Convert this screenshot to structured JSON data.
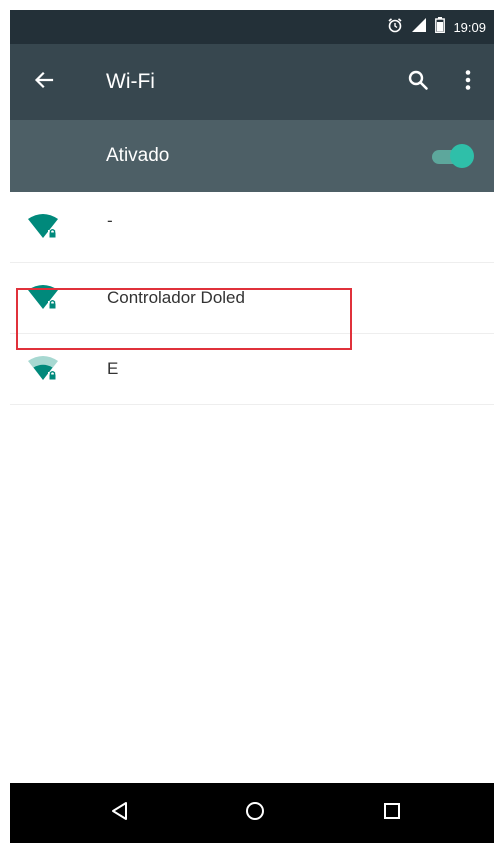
{
  "status_bar": {
    "time": "19:09",
    "icons": [
      "alarm-icon",
      "signal-icon",
      "battery-icon"
    ]
  },
  "app_bar": {
    "title": "Wi-Fi",
    "icons": [
      "back-arrow-icon",
      "search-icon",
      "more-vert-icon"
    ]
  },
  "wifi_toggle": {
    "label": "Ativado",
    "state": "on"
  },
  "networks": [
    {
      "name": "-",
      "secured": true,
      "signal_strength": "strong"
    },
    {
      "name": "Controlador Doled",
      "secured": true,
      "signal_strength": "strong",
      "highlighted": true
    },
    {
      "name": "E",
      "secured": true,
      "signal_strength": "medium"
    }
  ],
  "nav_bar": {
    "buttons": [
      "back-triangle-icon",
      "home-circle-icon",
      "recents-square-icon"
    ]
  },
  "colors": {
    "status_bar": "#233038",
    "app_bar": "#37474f",
    "toggle_bar": "#4d5f66",
    "accent": "#009688",
    "highlight": "#e0313b"
  }
}
